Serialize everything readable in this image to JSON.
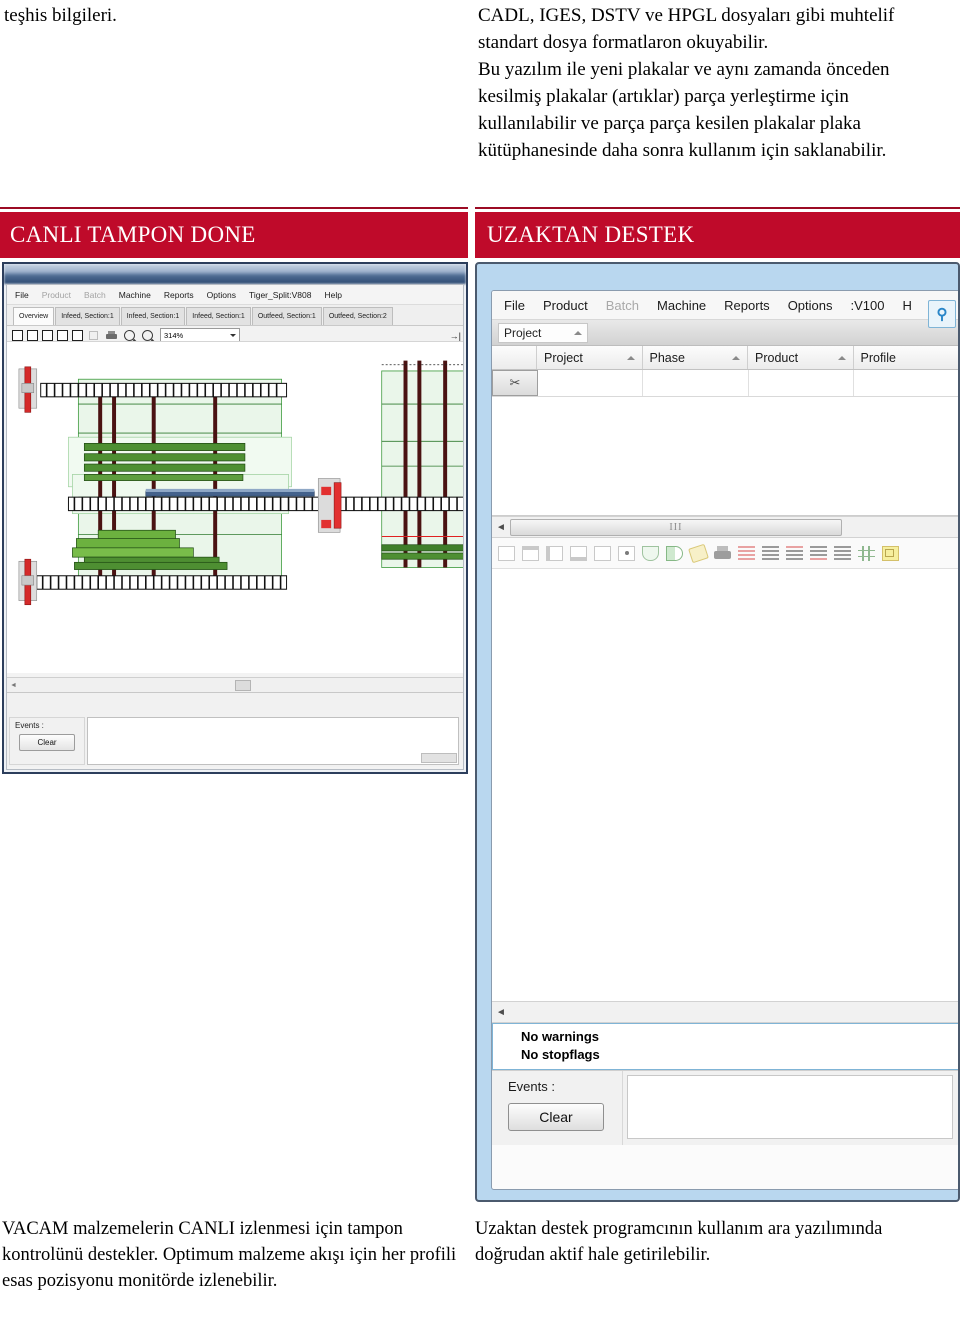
{
  "intro": {
    "left_text": "teşhis bilgileri.",
    "right_paragraphs": [
      "CADL, IGES, DSTV ve HPGL dosyaları gibi muhtelif standart dosya formatlaron okuyabilir.",
      "Bu yazılım ile yeni plakalar ve aynı zamanda önceden kesilmiş plakalar (artıklar) parça yerleştirme için kullanılabilir ve parça parça kesilen plakalar plaka kütüphanesinde daha sonra kullanım için saklanabilir."
    ]
  },
  "banners": {
    "left": "CANLI TAMPON DONE",
    "right": "UZAKTAN DESTEK",
    "color": "#bf0a2a",
    "rule_color": "#9c0b24",
    "text_color": "#ffffff"
  },
  "left_app": {
    "menu": [
      {
        "label": "File",
        "dim": false
      },
      {
        "label": "Product",
        "dim": true
      },
      {
        "label": "Batch",
        "dim": true
      },
      {
        "label": "Machine",
        "dim": false
      },
      {
        "label": "Reports",
        "dim": false
      },
      {
        "label": "Options",
        "dim": false
      },
      {
        "label": "Tiger_Split:V808",
        "dim": false
      },
      {
        "label": "Help",
        "dim": false
      }
    ],
    "tabs": [
      {
        "label": "Overview",
        "active": true
      },
      {
        "label": "Infeed, Section:1",
        "active": false
      },
      {
        "label": "Infeed, Section:1",
        "active": false
      },
      {
        "label": "Infeed, Section:1",
        "active": false
      },
      {
        "label": "Outfeed, Section:1",
        "active": false
      },
      {
        "label": "Outfeed, Section:2",
        "active": false
      }
    ],
    "toolbar": {
      "zoom_value": "314%",
      "scroll_right_glyph": "→|"
    },
    "events": {
      "label": "Events :",
      "clear_label": "Clear"
    },
    "scroll_left_glyph": "◄"
  },
  "right_app": {
    "menu": [
      {
        "label": "File",
        "dim": false
      },
      {
        "label": "Product",
        "dim": false
      },
      {
        "label": "Batch",
        "dim": true
      },
      {
        "label": "Machine",
        "dim": false
      },
      {
        "label": "Reports",
        "dim": false
      },
      {
        "label": "Options",
        "dim": false
      },
      {
        "label": ":V100",
        "dim": false
      },
      {
        "label": "H",
        "dim": false
      }
    ],
    "group_chip": "Project",
    "grid_columns": [
      "Project",
      "Phase",
      "Product",
      "Profile"
    ],
    "row_corner_icon": "cut-icon",
    "hscroll_grip": "III",
    "hscroll_arrow": "◄",
    "status": {
      "warnings": "No warnings",
      "stopflags": "No stopflags"
    },
    "events": {
      "label": "Events :",
      "clear_label": "Clear"
    },
    "side_icon": "magnifier-icon"
  },
  "captions": {
    "left": "VACAM malzemelerin CANLI izlenmesi için tampon kontrolünü destekler. Optimum malzeme akışı için her profili esas pozisyonu monitörde izlenebilir.",
    "right": "Uzaktan destek programcının kullanım ara yazılımında doğrudan aktif hale getirilebilir."
  }
}
